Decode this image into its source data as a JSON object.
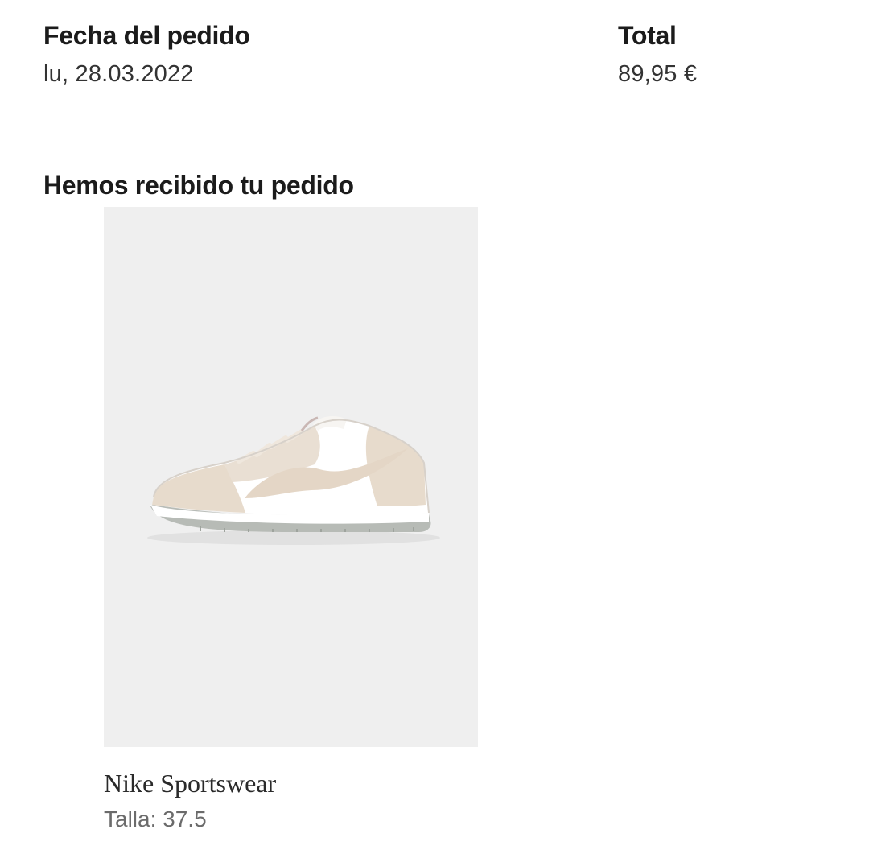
{
  "order": {
    "date_label": "Fecha del pedido",
    "date_value": "lu, 28.03.2022",
    "total_label": "Total",
    "total_value": "89,95 €"
  },
  "section": {
    "title": "Hemos recibido tu pedido"
  },
  "product": {
    "image_icon": "sneaker-image",
    "brand": "Nike Sportswear",
    "size": "Talla: 37.5",
    "colors": {
      "background": "#efefef",
      "upper_beige": "#e8dccf",
      "upper_white": "#ffffff",
      "sole_grey": "#b9bdb8"
    }
  }
}
